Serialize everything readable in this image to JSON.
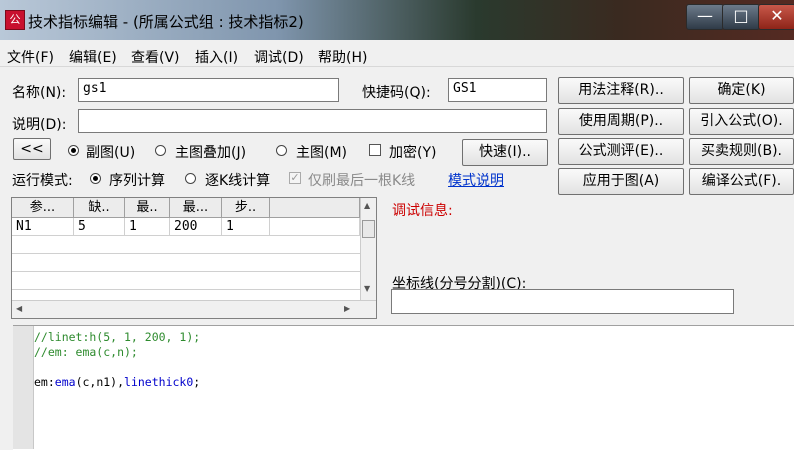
{
  "window": {
    "title": "技术指标编辑 - (所属公式组 : 技术指标2)",
    "icon": "formula-app-icon",
    "controls": {
      "minimize": "—",
      "maximize": "□",
      "close": "✕"
    }
  },
  "menu": [
    "文件(F)",
    "编辑(E)",
    "查看(V)",
    "插入(I)",
    "调试(D)",
    "帮助(H)"
  ],
  "form": {
    "name_label": "名称(N):",
    "name_value": "gs1",
    "shortcut_label": "快捷码(Q):",
    "shortcut_value": "GS1",
    "desc_label": "说明(D):",
    "desc_value": "",
    "collapse_btn": "<<",
    "radio_sub": "副图(U)",
    "radio_overlay": "主图叠加(J)",
    "radio_main": "主图(M)",
    "check_encrypt": "加密(Y)",
    "quick_btn": "快速(I)..",
    "run_mode_label": "运行模式:",
    "run_seq": "序列计算",
    "run_bar": "逐K线计算",
    "refresh_last": "仅刷最后一根K线",
    "mode_link": "模式说明"
  },
  "buttons": {
    "usage_note": "用法注释(R)..",
    "confirm": "确定(K)",
    "period": "使用周期(P)..",
    "import": "引入公式(O).",
    "test": "公式测评(E)..",
    "trade_rule": "买卖规则(B).",
    "apply": "应用于图(A)",
    "compile": "编译公式(F)."
  },
  "params": {
    "headers": [
      "参...",
      "缺..",
      "最..",
      "最...",
      "步.."
    ],
    "rows": [
      [
        "N1",
        "5",
        "1",
        "200",
        "1"
      ]
    ]
  },
  "debug_label": "调试信息:",
  "axis_label": "坐标线(分号分割)(C):",
  "axis_value": "",
  "code": {
    "line1": "//linet:h(5, 1, 200, 1);",
    "line2": "//em: ema(c,n);",
    "line3": "",
    "line4_a": "em:",
    "line4_b": "ema",
    "line4_c": "(c,n1),",
    "line4_d": "linethick0",
    "line4_e": ";"
  },
  "colors": {
    "comment": "#2e8b2e",
    "keyword": "#0000cc",
    "debug": "#cc0000",
    "link": "#0033cc"
  }
}
